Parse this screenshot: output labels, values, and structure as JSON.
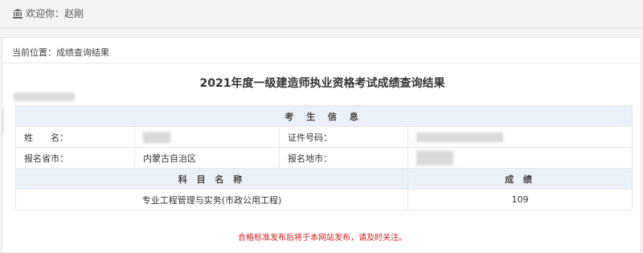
{
  "header": {
    "welcome_text": "欢迎你：赵刚",
    "icon": "bank-icon"
  },
  "breadcrumb": {
    "text": "当前位置：成绩查询结果"
  },
  "page_title": "2021年度一级建造师执业资格考试成绩查询结果",
  "candidate_info": {
    "section_title": "考 生 信 息",
    "name_label": "姓　　名：",
    "id_label": "证件号码：",
    "province_label": "报名省市：",
    "province_value": "内蒙古自治区",
    "city_label": "报名地市："
  },
  "scores": {
    "subject_header": "科 目 名 称",
    "score_header": "成 绩",
    "rows": [
      {
        "subject": "专业工程管理与实务(市政公用工程)",
        "score": "109"
      }
    ]
  },
  "notice": "合格标准发布后将于本网站发布，请及时关注。",
  "colors": {
    "header_bg": "#eaf1f8",
    "notice_red": "#d22020",
    "border": "#e3e8ee"
  }
}
